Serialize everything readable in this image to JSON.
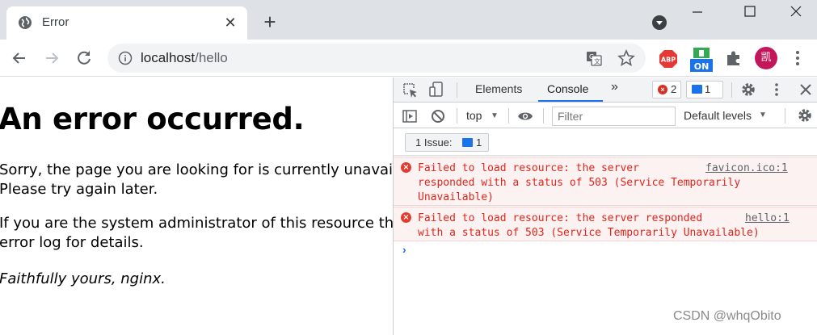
{
  "tab": {
    "title": "Error",
    "close_glyph": "✕"
  },
  "new_tab_glyph": "+",
  "address": {
    "host": "localhost",
    "path": "/hello"
  },
  "profile": {
    "avatar_text": "凯"
  },
  "extensions": [
    "abp-icon",
    "on-extension-icon",
    "extensions-puzzle-icon"
  ],
  "page": {
    "heading": "An error occurred.",
    "paragraph1_line1": "Sorry, the page you are looking for is currently unavailable.",
    "paragraph1_line2": "Please try again later.",
    "paragraph2_line1": "If you are the system administrator of this resource then you should check the",
    "paragraph2_line2": "error log for details.",
    "paragraph3": "Faithfully yours, nginx."
  },
  "devtools": {
    "tabs": [
      "Elements",
      "Console"
    ],
    "active_tab": "Console",
    "more_tabs_glyph": "»",
    "error_count": "2",
    "message_count": "1",
    "context": "top",
    "filter_placeholder": "Filter",
    "levels": "Default levels",
    "issues_label": "1 Issue:",
    "issues_count": "1",
    "messages": [
      {
        "text": "Failed to load resource: the server\nresponded with a status of 503 (Service Temporarily\nUnavailable)",
        "source": "favicon.ico:1"
      },
      {
        "text": "Failed to load resource: the server responded\nwith a status of 503 (Service Temporarily Unavailable)",
        "source": "hello:1"
      }
    ],
    "prompt_glyph": "›"
  },
  "watermark": "CSDN @whqObito",
  "colors": {
    "error_red": "#e0261c",
    "accent_blue": "#1a73e8",
    "error_bg": "#fdf2f2"
  }
}
